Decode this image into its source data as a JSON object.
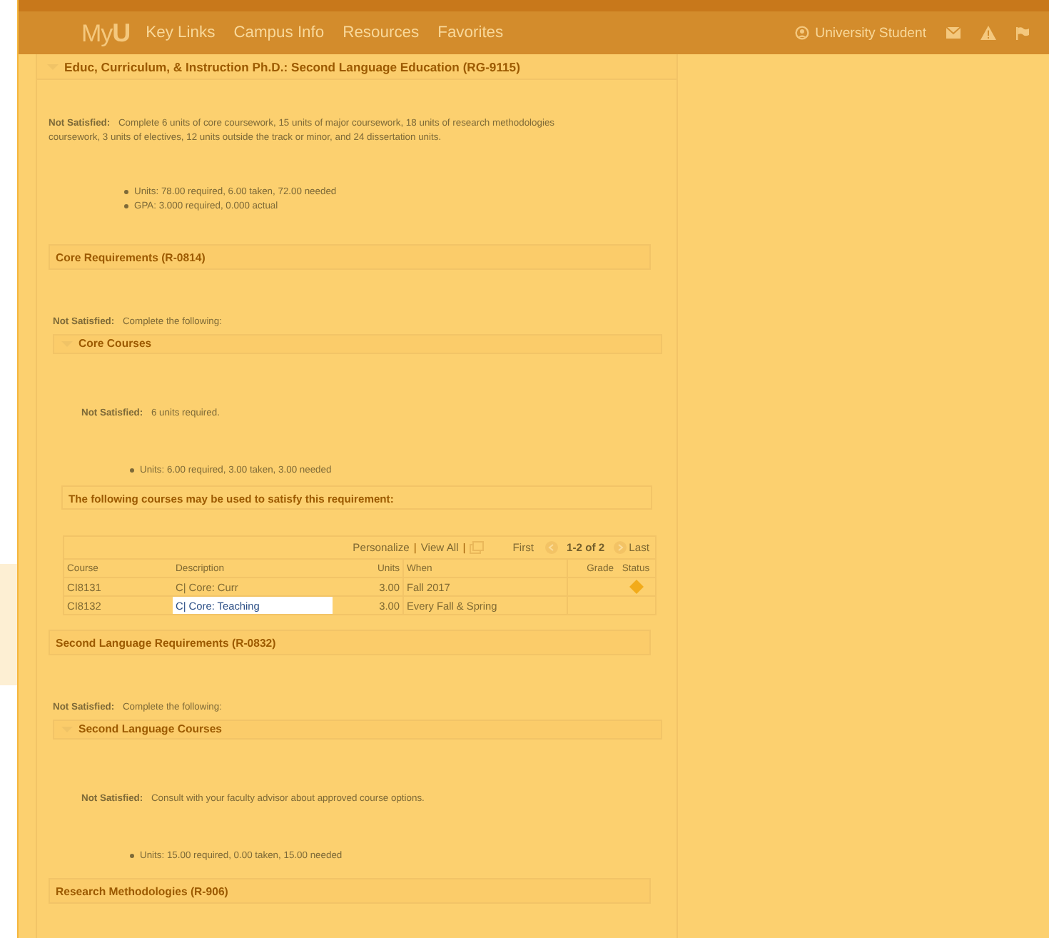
{
  "header": {
    "logo": "My**U**",
    "nav": [
      "Key Links",
      "Campus Info",
      "Resources",
      "Favorites"
    ],
    "user": "University Student"
  },
  "requirement": {
    "title": "Educ, Curriculum, & Instruction Ph.D.: Second Language Education (RG-9115)",
    "expanded": true,
    "children": [
      {
        "kind": "status",
        "label": "Not Satisfied:",
        "text": "Complete 6 units of core coursework, 15 units of major coursework, 18 units of research methodologies coursework, 3 units of electives, 12 units outside the track or minor, and 24 dissertation units."
      },
      {
        "kind": "bullets",
        "items": [
          "Units: 78.00 required, 6.00 taken, 72.00 needed",
          "GPA: 3.000 required, 0.000 actual"
        ]
      },
      {
        "kind": "section",
        "title": "Core Requirements (R-0814)",
        "children": [
          {
            "kind": "status",
            "label": "Not Satisfied:",
            "text": "Complete the following:"
          },
          {
            "kind": "subsection",
            "title": "Core Courses",
            "expanded": true,
            "children": [
              {
                "kind": "status",
                "label": "Not Satisfied:",
                "text": "6 units required."
              },
              {
                "kind": "bullets",
                "items": [
                  "Units: 6.00 required, 3.00 taken, 3.00 needed"
                ]
              },
              {
                "kind": "note",
                "text": "The following courses may be used to satisfy this requirement:"
              },
              {
                "kind": "table",
                "toolbar": {
                  "personalize": "Personalize",
                  "separator_1": "|",
                  "view_all": "View All",
                  "separator_2": "|",
                  "first": "First",
                  "range": "1-2 of 2",
                  "last": "Last"
                },
                "columns": [
                  "Course",
                  "Description",
                  "Units",
                  "When",
                  "Grade",
                  "Status"
                ],
                "rows": [
                  {
                    "course": "CI8131",
                    "description": "C| Core: Curr",
                    "units": "3.00",
                    "when": "Fall 2017",
                    "in_progress": true,
                    "highlighted": false
                  },
                  {
                    "course": "CI8132",
                    "description": "C| Core: Teaching",
                    "units": "3.00",
                    "when": "Every Fall & Spring",
                    "in_progress": false,
                    "highlighted": true
                  }
                ]
              }
            ]
          }
        ]
      },
      {
        "kind": "section",
        "title": "Second Language Requirements (R-0832)",
        "children": [
          {
            "kind": "status",
            "label": "Not Satisfied:",
            "text": "Complete the following:"
          },
          {
            "kind": "subsection",
            "title": "Second Language Courses",
            "expanded": true,
            "children": [
              {
                "kind": "status",
                "label": "Not Satisfied:",
                "text": "Consult with your faculty advisor about approved course options."
              },
              {
                "kind": "bullets",
                "items": [
                  "Units: 15.00 required, 0.00 taken, 15.00 needed"
                ]
              }
            ]
          }
        ]
      },
      {
        "kind": "section",
        "title": "Research Methodologies (R-906)"
      }
    ]
  }
}
